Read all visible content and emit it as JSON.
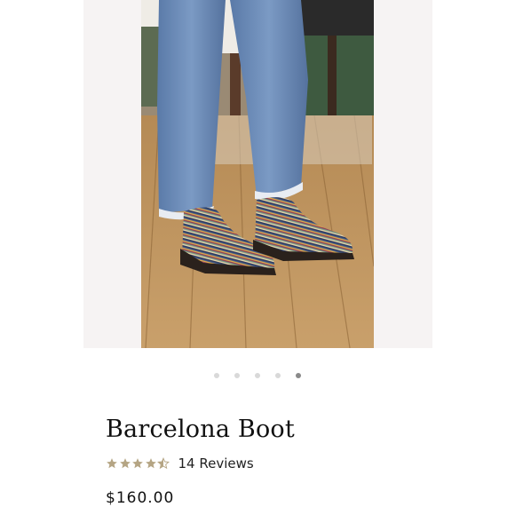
{
  "product": {
    "title": "Barcelona Boot",
    "rating": 4.5,
    "rating_max": 5,
    "reviews_label": "14 Reviews",
    "price": "$160.00"
  },
  "gallery": {
    "slide_count": 5,
    "active_slide": 5
  },
  "colors": {
    "star": "#b5a584",
    "dot_inactive": "#d9d9d9",
    "dot_active": "#8a8a8a"
  },
  "icons": {
    "star": "star-icon",
    "half_star": "half-star-icon"
  }
}
